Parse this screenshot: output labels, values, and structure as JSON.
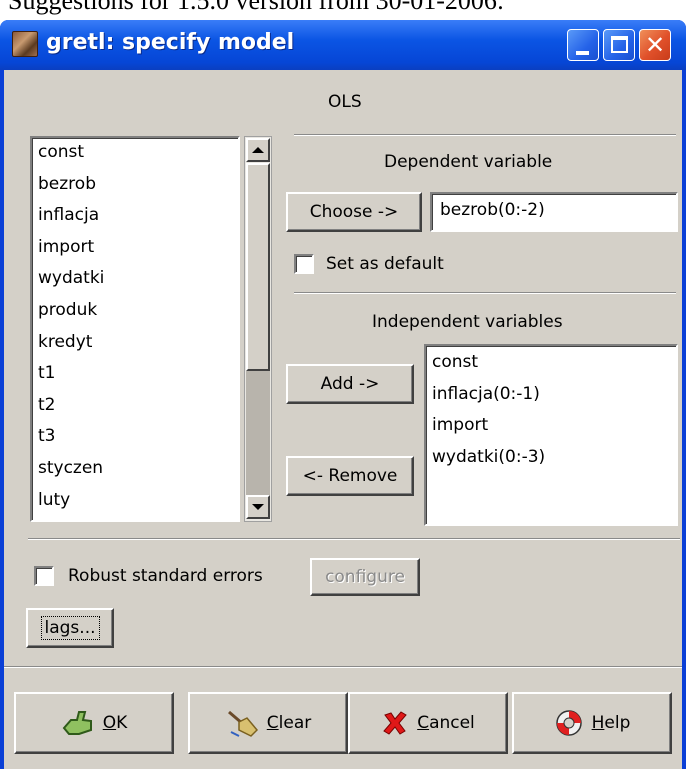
{
  "page_caption": "Suggestions for 1.5.0 version from 30-01-2006:",
  "window": {
    "title": "gretl: specify model",
    "controls": [
      "minimize",
      "maximize",
      "close"
    ]
  },
  "model": {
    "estimator": "OLS"
  },
  "variable_list": {
    "items": [
      "const",
      "bezrob",
      "inflacja",
      "import",
      "wydatki",
      "produk",
      "kredyt",
      "t1",
      "t2",
      "t3",
      "styczen",
      "luty"
    ]
  },
  "dependent": {
    "heading": "Dependent variable",
    "choose_label": "Choose ->",
    "value": "bezrob(0:-2)",
    "default_checkbox_label": "Set as default",
    "default_checked": false
  },
  "independent": {
    "heading": "Independent variables",
    "add_label": "Add ->",
    "remove_label": "<- Remove",
    "items": [
      "const",
      "inflacja(0:-1)",
      "import",
      "wydatki(0:-3)"
    ]
  },
  "options": {
    "robust_label": "Robust standard errors",
    "robust_checked": false,
    "configure_label": "configure",
    "lags_label": "lags..."
  },
  "footer": {
    "ok_mnemonic": "O",
    "ok_rest": "K",
    "clear_mnemonic": "C",
    "clear_rest": "lear",
    "cancel_mnemonic": "C",
    "cancel_rest": "ancel",
    "help_mnemonic": "H",
    "help_rest": "elp"
  },
  "icons": {
    "app": "gretl-app-icon",
    "ok": "ok-hand-icon",
    "clear": "broom-icon",
    "cancel": "red-x-icon",
    "help": "lifebuoy-icon"
  },
  "colors": {
    "titlebar": "#0b55e4",
    "dialog_bg": "#d4d0c8",
    "close_button": "#e0502a"
  }
}
